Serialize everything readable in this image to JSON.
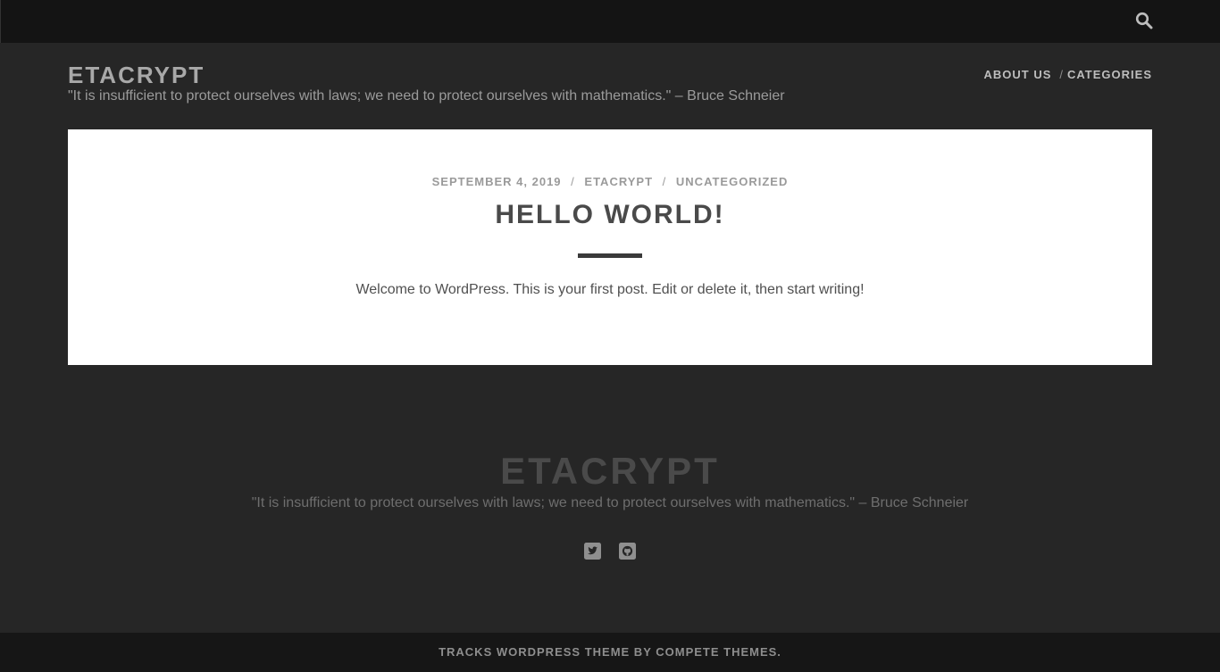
{
  "site": {
    "title": "ETACRYPT",
    "tagline": "\"It is insufficient to protect ourselves with laws; we need to protect ourselves with mathematics.\" – Bruce Schneier"
  },
  "menu": {
    "items": [
      {
        "label": "ABOUT US"
      },
      {
        "label": "CATEGORIES"
      }
    ],
    "separator": "/"
  },
  "post": {
    "date": "SEPTEMBER 4, 2019",
    "author": "ETACRYPT",
    "category": "UNCATEGORIZED",
    "meta_separator": "/",
    "title": "HELLO WORLD!",
    "excerpt": "Welcome to WordPress. This is your first post. Edit or delete it, then start writing!"
  },
  "footer": {
    "title": "ETACRYPT",
    "tagline": "\"It is insufficient to protect ourselves with laws; we need to protect ourselves with mathematics.\" – Bruce Schneier",
    "social": [
      {
        "icon": "twitter-square-icon"
      },
      {
        "icon": "github-square-icon"
      }
    ],
    "credit": "TRACKS WORDPRESS THEME BY COMPETE THEMES."
  },
  "colors": {
    "background": "#262626",
    "top_bar": "#141414",
    "bottom_bar": "#161616",
    "card": "#ffffff",
    "accent_rule": "#3a3a3a"
  }
}
